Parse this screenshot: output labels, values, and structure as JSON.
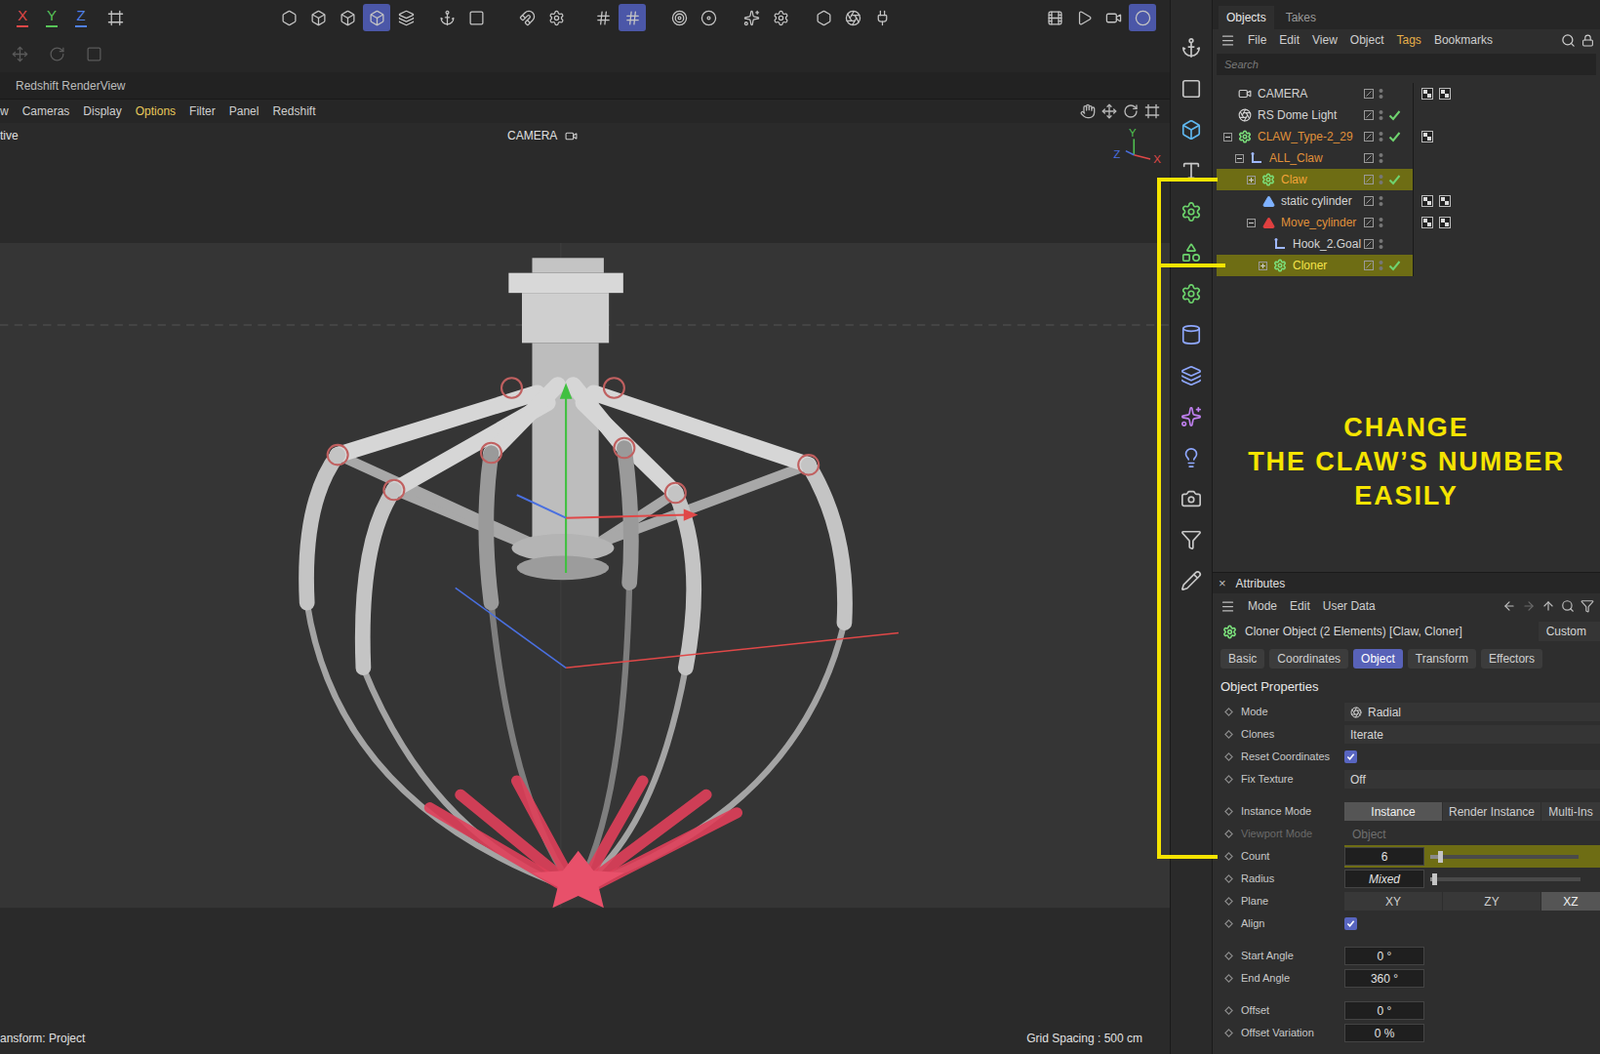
{
  "toolbar": {
    "axes": [
      {
        "label": "X",
        "color": "#e04848"
      },
      {
        "label": "Y",
        "color": "#58c458"
      },
      {
        "label": "Z",
        "color": "#5080e8"
      }
    ],
    "button_groups": [
      [
        {
          "selected": false
        }
      ],
      [
        {
          "selected": false
        },
        {
          "selected": false
        },
        {
          "selected": false
        },
        {
          "selected": true
        },
        {
          "selected": false
        }
      ],
      [
        {
          "selected": false
        },
        {
          "selected": false
        }
      ],
      [
        {
          "selected": false
        },
        {
          "selected": false
        }
      ],
      [
        {
          "selected": false
        },
        {
          "selected": true
        }
      ],
      [
        {
          "selected": false
        },
        {
          "selected": false
        }
      ],
      [
        {
          "selected": false
        },
        {
          "selected": false
        }
      ],
      [
        {
          "selected": false
        },
        {
          "selected": false
        },
        {
          "selected": false
        }
      ],
      [
        {
          "selected": false
        },
        {
          "selected": false
        },
        {
          "selected": false
        },
        {
          "selected": true
        }
      ]
    ],
    "secondary_buttons": [
      {
        "disabled": true
      },
      {
        "disabled": true
      },
      {
        "disabled": true
      }
    ]
  },
  "render_view": {
    "title": "Redshift RenderView"
  },
  "viewport": {
    "menu": [
      {
        "label": "w",
        "selected": false
      },
      {
        "label": "Cameras",
        "selected": false
      },
      {
        "label": "Display",
        "selected": false
      },
      {
        "label": "Options",
        "selected": true
      },
      {
        "label": "Filter",
        "selected": false
      },
      {
        "label": "Panel",
        "selected": false
      },
      {
        "label": "Redshift",
        "selected": false
      }
    ],
    "view_label": "tive",
    "camera_label": "CAMERA",
    "axis_gizmo": {
      "y": "Y",
      "z": "Z",
      "x": "X"
    },
    "status_left": "ansform: Project",
    "status_right": "Grid Spacing : 500 cm"
  },
  "objects_panel": {
    "tabs": [
      {
        "label": "Objects",
        "selected": true
      },
      {
        "label": "Takes",
        "selected": false
      }
    ],
    "menu": [
      {
        "label": "File",
        "selected": false
      },
      {
        "label": "Edit",
        "selected": false
      },
      {
        "label": "View",
        "selected": false
      },
      {
        "label": "Object",
        "selected": false
      },
      {
        "label": "Tags",
        "selected": true
      },
      {
        "label": "Bookmarks",
        "selected": false
      }
    ],
    "search": {
      "placeholder": "Search"
    },
    "rows": [
      {
        "name": "CAMERA",
        "depth": 0,
        "kind": "camera",
        "expanded": null,
        "highlighted": false,
        "color": "#d4d4d4",
        "enabled": false,
        "tag_count": 2
      },
      {
        "name": "RS Dome Light",
        "depth": 0,
        "kind": "light",
        "expanded": null,
        "highlighted": false,
        "color": "#d4d4d4",
        "enabled": true,
        "tag_count": 0
      },
      {
        "name": "CLAW_Type-2_29",
        "depth": 0,
        "kind": "cloner",
        "expanded": true,
        "highlighted": false,
        "color": "#e0913a",
        "enabled": true,
        "tag_count": 1
      },
      {
        "name": "ALL_Claw",
        "depth": 1,
        "kind": "null",
        "expanded": true,
        "highlighted": false,
        "color": "#e0913a",
        "enabled": false,
        "tag_count": 0
      },
      {
        "name": "Claw",
        "depth": 2,
        "kind": "cloner",
        "expanded": false,
        "highlighted": true,
        "color": "#f2a43a",
        "enabled": true,
        "tag_count": 0
      },
      {
        "name": "static cylinder",
        "depth": 2,
        "kind": "cone",
        "expanded": null,
        "highlighted": false,
        "color": "#d4d4d4",
        "enabled": false,
        "tag_count": 2
      },
      {
        "name": "Move_cylinder",
        "depth": 2,
        "kind": "ik-cone",
        "expanded": true,
        "highlighted": false,
        "color": "#e0913a",
        "enabled": false,
        "tag_count": 2
      },
      {
        "name": "Hook_2.Goal",
        "depth": 3,
        "kind": "null",
        "expanded": null,
        "highlighted": false,
        "color": "#d4d4d4",
        "enabled": false,
        "tag_count": 0
      },
      {
        "name": "Cloner",
        "depth": 3,
        "kind": "cloner",
        "expanded": false,
        "highlighted": true,
        "color": "#f5e44a",
        "enabled": true,
        "tag_count": 0
      }
    ]
  },
  "annotation": {
    "lines": [
      "CHANGE",
      "THE CLAW’S NUMBER",
      "EASILY"
    ]
  },
  "attributes": {
    "close": "×",
    "title": "Attributes",
    "menu": [
      "Mode",
      "Edit",
      "User Data"
    ],
    "object_line": "Cloner Object (2 Elements) [Claw, Cloner]",
    "preset": "Custom",
    "tabs": [
      {
        "label": "Basic",
        "selected": false
      },
      {
        "label": "Coordinates",
        "selected": false
      },
      {
        "label": "Object",
        "selected": true
      },
      {
        "label": "Transform",
        "selected": false
      },
      {
        "label": "Effectors",
        "selected": false
      }
    ],
    "section": "Object Properties",
    "groups": [
      [
        {
          "label": "Mode",
          "kind": "dropdown",
          "value": "Radial",
          "icon": true,
          "disabled": false,
          "highlighted": false
        },
        {
          "label": "Clones",
          "kind": "dropdown",
          "value": "Iterate",
          "icon": false,
          "disabled": false,
          "highlighted": false
        },
        {
          "label": "Reset Coordinates",
          "kind": "checkbox",
          "checked": true,
          "disabled": false,
          "highlighted": false
        },
        {
          "label": "Fix Texture",
          "kind": "dropdown",
          "value": "Off",
          "icon": false,
          "disabled": false,
          "highlighted": false
        }
      ],
      [
        {
          "label": "Instance Mode",
          "kind": "segmented",
          "options": [
            {
              "label": "Instance",
              "selected": true
            },
            {
              "label": "Render Instance",
              "selected": false
            },
            {
              "label": "Multi-Ins",
              "selected": false
            }
          ],
          "disabled": false,
          "highlighted": false
        },
        {
          "label": "Viewport Mode",
          "kind": "dropdown",
          "value": "Object",
          "icon": false,
          "disabled": true,
          "highlighted": false
        },
        {
          "label": "Count",
          "kind": "slider",
          "value": "6",
          "level": 0.05,
          "mixed": false,
          "disabled": false,
          "highlighted": true
        },
        {
          "label": "Radius",
          "kind": "slider",
          "value": "Mixed",
          "level": 0.01,
          "mixed": true,
          "disabled": false,
          "highlighted": false
        },
        {
          "label": "Plane",
          "kind": "segmented",
          "options": [
            {
              "label": "XY",
              "selected": false
            },
            {
              "label": "ZY",
              "selected": false
            },
            {
              "label": "XZ",
              "selected": true
            }
          ],
          "disabled": false,
          "highlighted": false
        },
        {
          "label": "Align",
          "kind": "checkbox",
          "checked": true,
          "disabled": false,
          "highlighted": false
        }
      ],
      [
        {
          "label": "Start Angle",
          "kind": "number",
          "value": "0 °",
          "disabled": false,
          "highlighted": false
        },
        {
          "label": "End Angle",
          "kind": "number",
          "value": "360 °",
          "disabled": false,
          "highlighted": false
        }
      ],
      [
        {
          "label": "Offset",
          "kind": "number",
          "value": "0 °",
          "disabled": false,
          "highlighted": false
        },
        {
          "label": "Offset Variation",
          "kind": "number",
          "value": "0 %",
          "disabled": false,
          "highlighted": false
        }
      ]
    ]
  }
}
